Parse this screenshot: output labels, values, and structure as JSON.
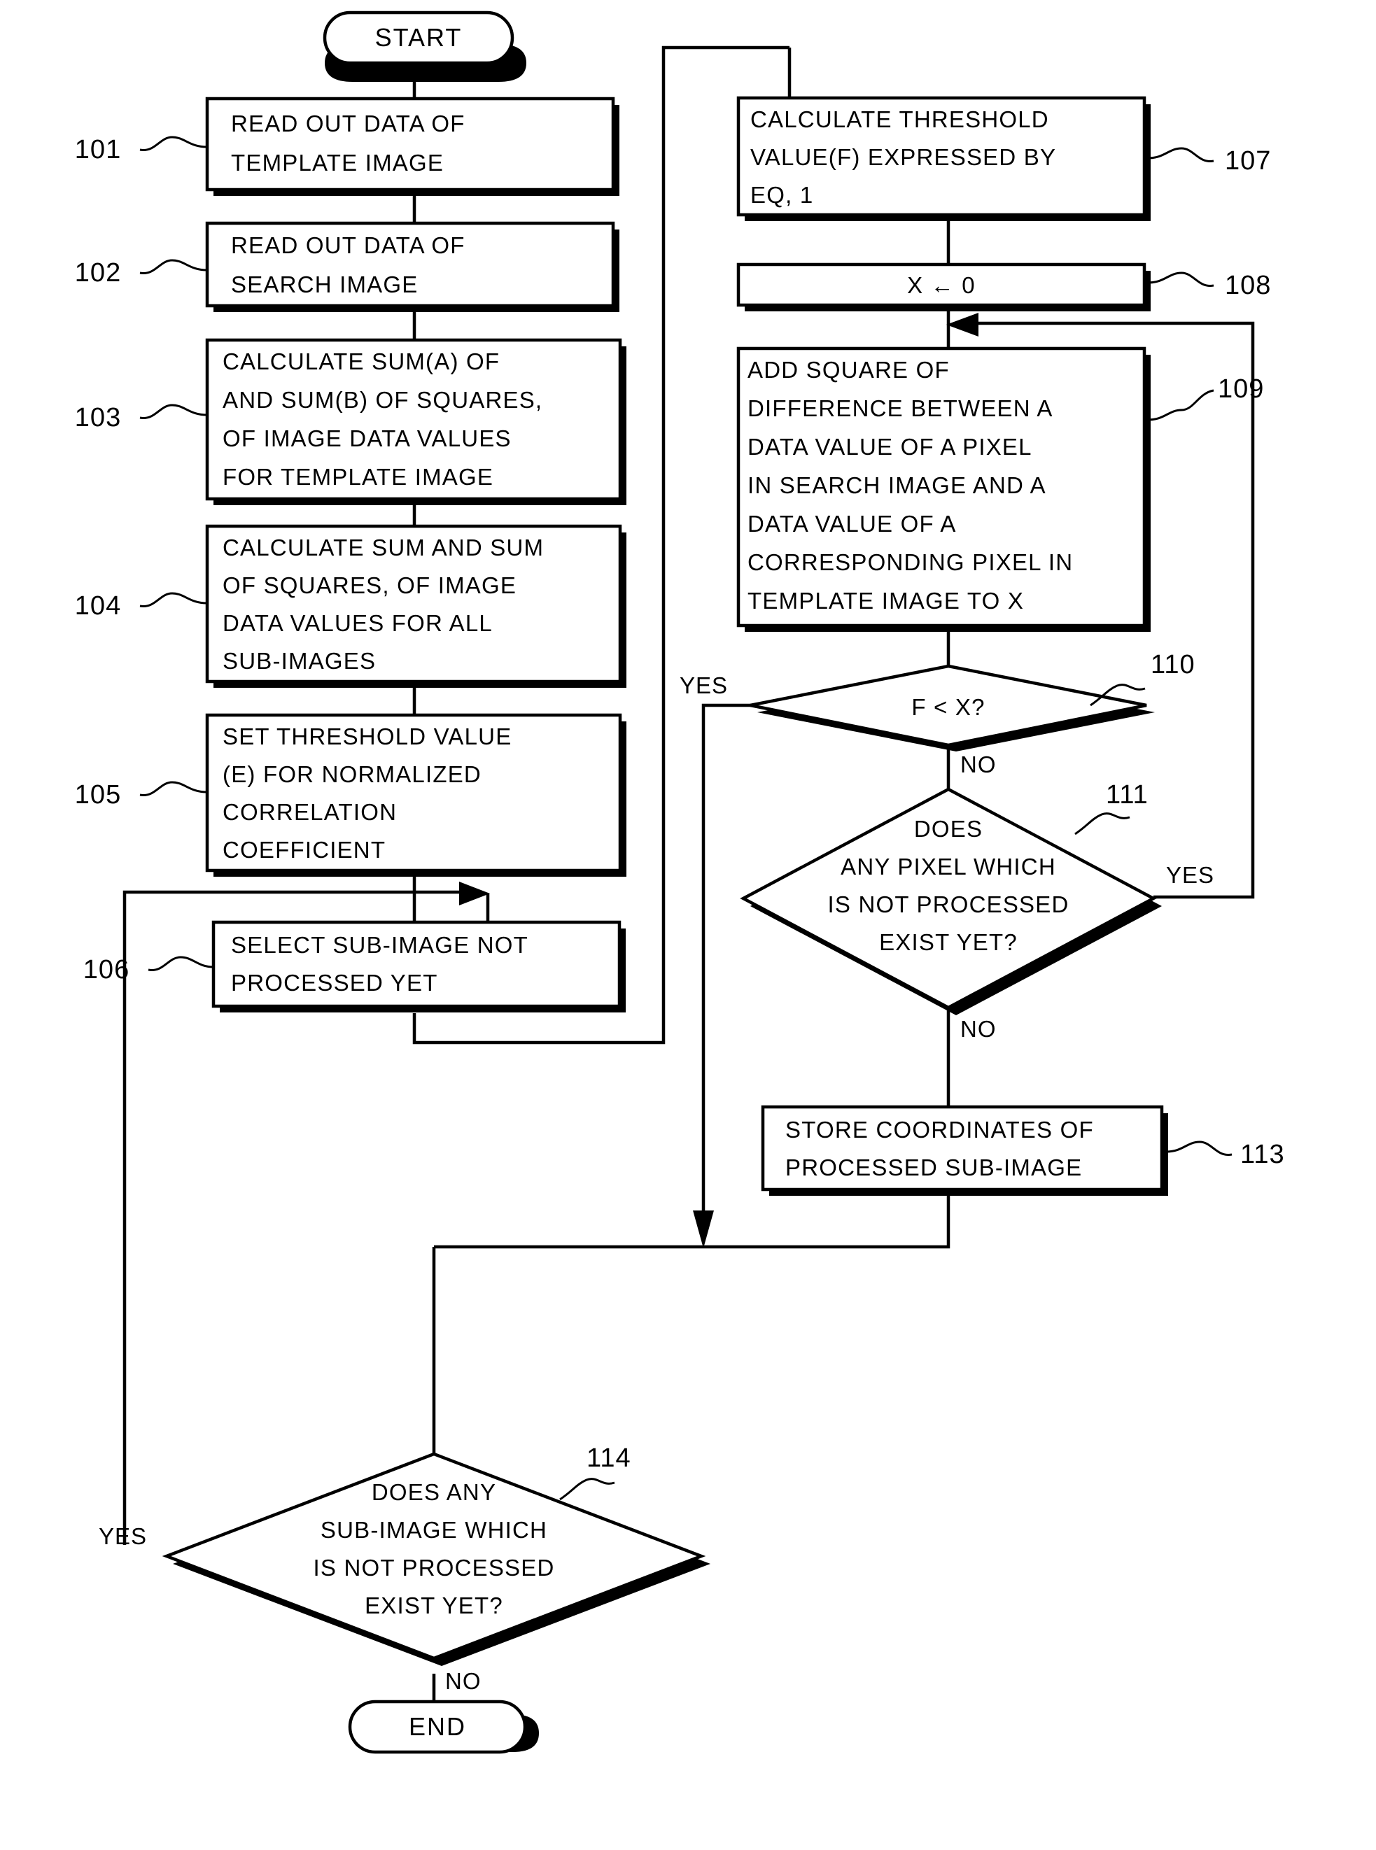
{
  "diagram": {
    "title": "Image matching process flowchart",
    "terminals": {
      "start": "START",
      "end": "END"
    },
    "branch_labels": {
      "yes": "YES",
      "no": "NO"
    },
    "nodes": [
      {
        "ref": "101",
        "type": "process",
        "lines": [
          "READ OUT DATA OF",
          "TEMPLATE IMAGE"
        ]
      },
      {
        "ref": "102",
        "type": "process",
        "lines": [
          "READ OUT DATA OF",
          "SEARCH IMAGE"
        ]
      },
      {
        "ref": "103",
        "type": "process",
        "lines": [
          "CALCULATE SUM(A) OF",
          "AND SUM(B) OF SQUARES,",
          "OF IMAGE DATA VALUES",
          "FOR TEMPLATE IMAGE"
        ]
      },
      {
        "ref": "104",
        "type": "process",
        "lines": [
          "CALCULATE SUM AND SUM",
          "OF SQUARES, OF IMAGE",
          "DATA VALUES FOR ALL",
          "SUB-IMAGES"
        ]
      },
      {
        "ref": "105",
        "type": "process",
        "lines": [
          "SET THRESHOLD VALUE",
          "(E) FOR NORMALIZED",
          "CORRELATION",
          "COEFFICIENT"
        ]
      },
      {
        "ref": "106",
        "type": "process",
        "lines": [
          "SELECT SUB-IMAGE NOT",
          "PROCESSED YET"
        ]
      },
      {
        "ref": "107",
        "type": "process",
        "lines": [
          "CALCULATE THRESHOLD",
          "VALUE(F) EXPRESSED BY",
          "EQ, 1"
        ]
      },
      {
        "ref": "108",
        "type": "process",
        "lines": [
          "X ← 0"
        ]
      },
      {
        "ref": "109",
        "type": "process",
        "lines": [
          "ADD SQUARE OF",
          "DIFFERENCE BETWEEN A",
          "DATA VALUE OF A PIXEL",
          "IN SEARCH IMAGE AND A",
          "DATA VALUE OF A",
          "CORRESPONDING PIXEL IN",
          "TEMPLATE IMAGE TO X"
        ]
      },
      {
        "ref": "110",
        "type": "decision",
        "lines": [
          "F < X?"
        ],
        "yes": "YES",
        "no": "NO"
      },
      {
        "ref": "111",
        "type": "decision",
        "lines": [
          "DOES",
          "ANY PIXEL WHICH",
          "IS NOT PROCESSED",
          "EXIST YET?"
        ],
        "yes": "YES",
        "no": "NO"
      },
      {
        "ref": "113",
        "type": "process",
        "lines": [
          "STORE COORDINATES OF",
          "PROCESSED SUB-IMAGE"
        ]
      },
      {
        "ref": "114",
        "type": "decision",
        "lines": [
          "DOES ANY",
          "SUB-IMAGE WHICH",
          "IS NOT PROCESSED",
          "EXIST YET?"
        ],
        "yes": "YES",
        "no": "NO"
      }
    ]
  },
  "colors": {
    "ink": "#000000",
    "paper": "#ffffff"
  }
}
